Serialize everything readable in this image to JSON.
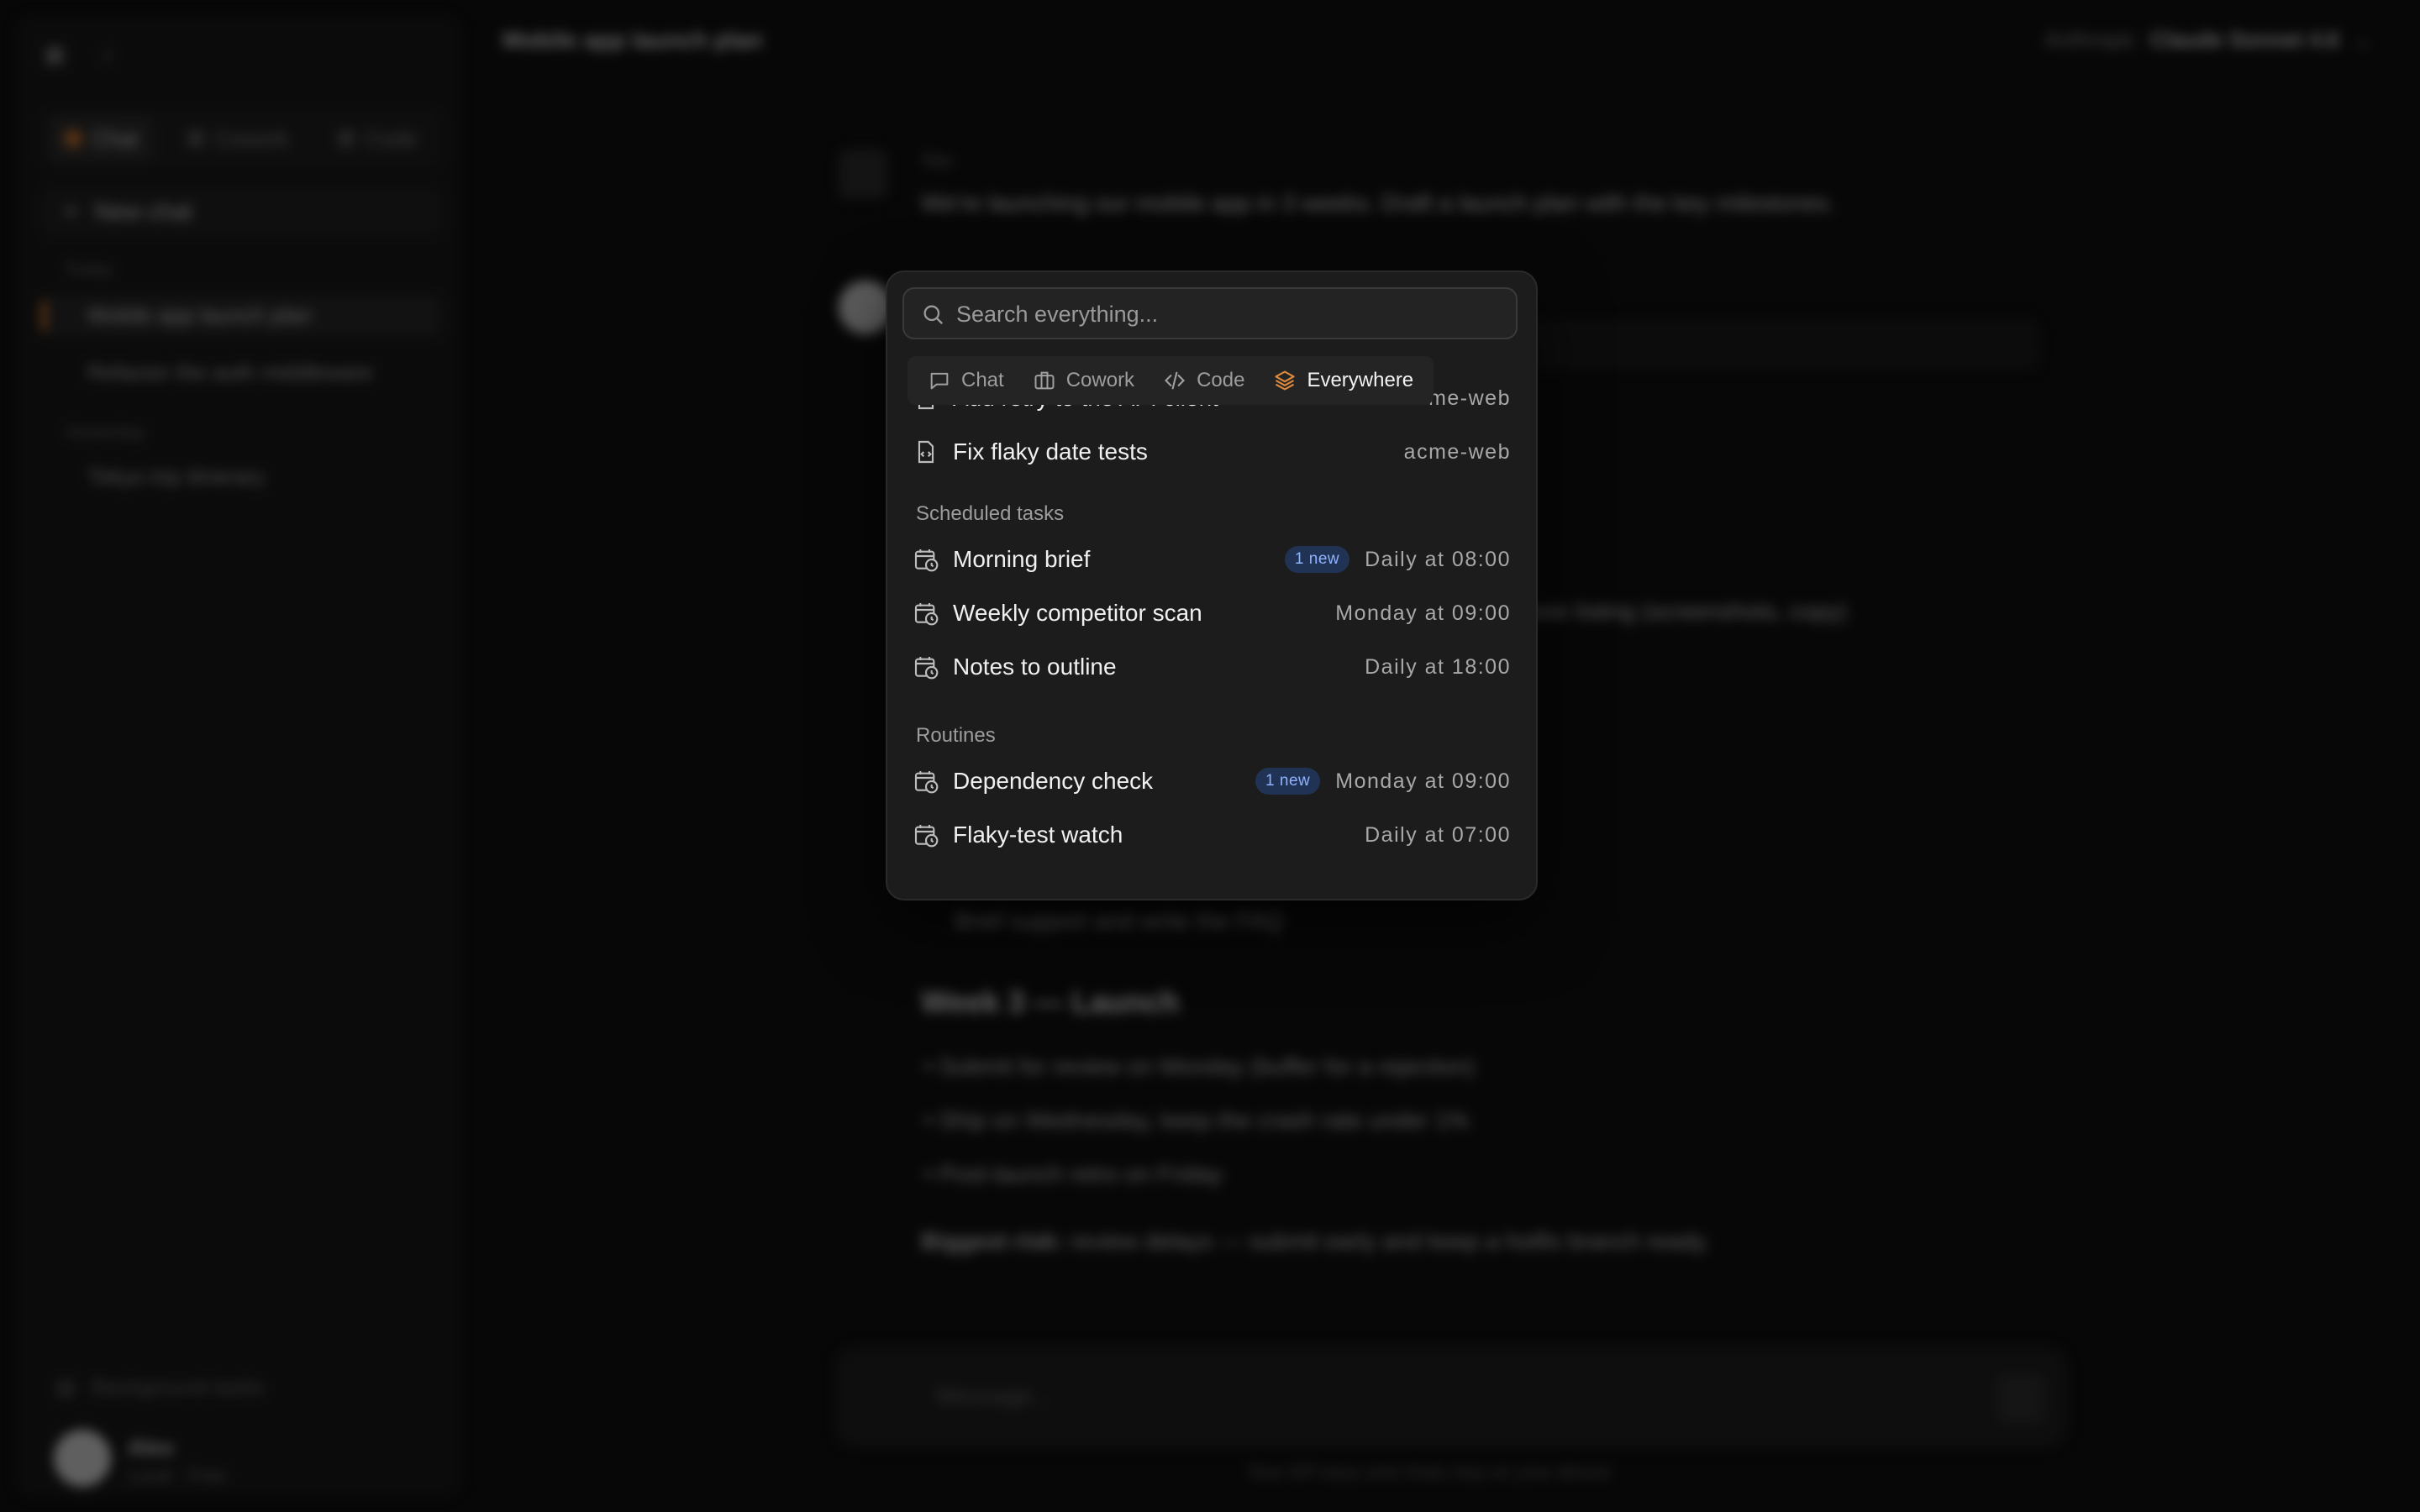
{
  "sidebar": {
    "tabs": [
      {
        "label": "Chat"
      },
      {
        "label": "Cowork"
      },
      {
        "label": "Code"
      }
    ],
    "new_chat": "New chat",
    "today_label": "Today",
    "today_items": [
      "Mobile app launch plan",
      "Refactor the auth middleware"
    ],
    "yesterday_label": "Yesterday",
    "yesterday_items": [
      "Tokyo trip itinerary"
    ],
    "background_tasks": "Background tasks",
    "user": {
      "name": "Alex",
      "plan": "Local · Free"
    }
  },
  "main": {
    "title": "Mobile app launch plan",
    "model_prefix": "Anthropic",
    "model_name": "Claude Sonnet 4.6",
    "you_label": "You",
    "user_message": "We're launching our mobile app in 3 weeks. Draft a launch plan with the key milestones.",
    "ai_lines": [
      "Finalize store listing (screenshots, copy)",
      "Brief support and write the FAQ"
    ],
    "week3_heading": "Week 3 — Launch",
    "week3_bullets": [
      "Submit for review on Monday (buffer for a rejection)",
      "Ship on Wednesday, keep the crash rate under 1%",
      "Post-launch retro on Friday"
    ],
    "risk_label": "Biggest risk:",
    "risk_text": "review delays — submit early and keep a hotfix branch ready.",
    "composer_placeholder": "Message...",
    "footer_note": "Your API keys and chats stay on your device"
  },
  "palette": {
    "search_placeholder": "Search everything...",
    "filters": [
      {
        "label": "Chat",
        "icon": "chat-bubble-icon"
      },
      {
        "label": "Cowork",
        "icon": "briefcase-icon"
      },
      {
        "label": "Code",
        "icon": "code-icon"
      },
      {
        "label": "Everywhere",
        "icon": "layers-icon",
        "active": true
      }
    ],
    "code_items": [
      {
        "title": "Add retry to the API client",
        "meta": "acme-web"
      },
      {
        "title": "Fix flaky date tests",
        "meta": "acme-web"
      }
    ],
    "scheduled_label": "Scheduled tasks",
    "scheduled_items": [
      {
        "title": "Morning brief",
        "badge": "1 new",
        "meta": "Daily at 08:00"
      },
      {
        "title": "Weekly competitor scan",
        "meta": "Monday at 09:00"
      },
      {
        "title": "Notes to outline",
        "meta": "Daily at 18:00"
      }
    ],
    "routines_label": "Routines",
    "routine_items": [
      {
        "title": "Dependency check",
        "badge": "1 new",
        "meta": "Monday at 09:00"
      },
      {
        "title": "Flaky-test watch",
        "meta": "Daily at 07:00"
      }
    ]
  },
  "colors": {
    "accent": "#d2762f",
    "badge_text": "#8fb3ff",
    "badge_bg": "#213354"
  }
}
